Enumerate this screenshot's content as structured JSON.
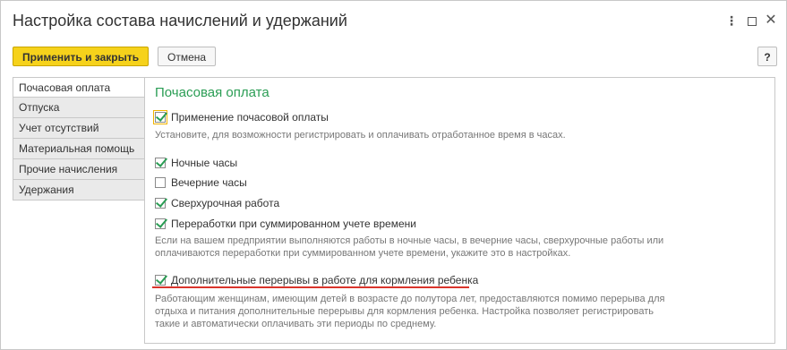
{
  "window": {
    "title": "Настройка состава начислений и удержаний",
    "controls": {
      "more": "⋮",
      "maximize": "□",
      "close": "✕"
    }
  },
  "toolbar": {
    "apply_close_label": "Применить и закрыть",
    "cancel_label": "Отмена",
    "help_label": "?"
  },
  "tabs": [
    {
      "label": "Почасовая оплата",
      "active": true
    },
    {
      "label": "Отпуска",
      "active": false
    },
    {
      "label": "Учет отсутствий",
      "active": false
    },
    {
      "label": "Материальная помощь",
      "active": false
    },
    {
      "label": "Прочие начисления",
      "active": false
    },
    {
      "label": "Удержания",
      "active": false
    }
  ],
  "content": {
    "section_title": "Почасовая оплата",
    "options": [
      {
        "label": "Применение почасовой оплаты",
        "checked": true
      },
      {
        "label": "Ночные часы",
        "checked": true
      },
      {
        "label": "Вечерние часы",
        "checked": false
      },
      {
        "label": "Сверхурочная работа",
        "checked": true
      },
      {
        "label": "Переработки при суммированном учете времени",
        "checked": true
      },
      {
        "label": "Дополнительные перерывы в работе для кормления ребенка",
        "checked": true
      }
    ],
    "hints": {
      "hourly": "Установите, для возможности регистрировать и оплачивать отработанное время в часах.",
      "overtime_line1": "Если на вашем предприятии выполняются работы в ночные часы, в вечерние часы, сверхурочные работы или",
      "overtime_line2": "оплачиваются переработки при суммированном учете времени, укажите это в настройках.",
      "breaks_line1": "Работающим женщинам, имеющим детей в возрасте до полутора лет, предоставляются помимо перерыва для",
      "breaks_line2": "отдыха и питания дополнительные перерывы для кормления ребенка. Настройка позволяет регистрировать",
      "breaks_line3": "такие и автоматически оплачивать эти периоды по среднему."
    }
  },
  "colors": {
    "accent_green": "#2a9d54",
    "primary_button": "#f6d21b",
    "highlight_underline": "#d9342b"
  }
}
